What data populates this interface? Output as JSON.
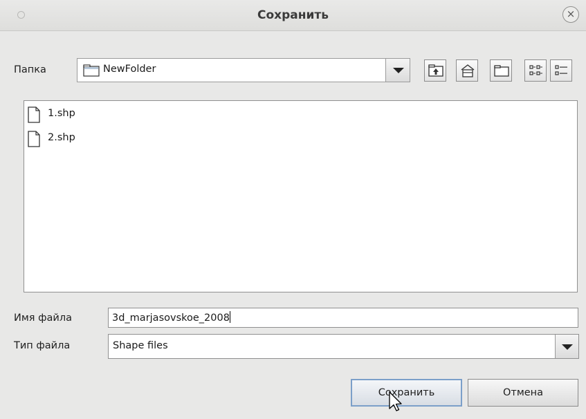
{
  "window": {
    "title": "Сохранить",
    "close_glyph": "×"
  },
  "folder": {
    "label": "Папка",
    "current": "NewFolder"
  },
  "toolbar": {
    "icons": [
      "up-one-level-icon",
      "home-icon",
      "new-folder-icon",
      "list-view-icon",
      "details-view-icon"
    ]
  },
  "files": [
    {
      "name": "1.shp",
      "icon": "file-icon"
    },
    {
      "name": "2.shp",
      "icon": "file-icon"
    }
  ],
  "filename": {
    "label": "Имя файла",
    "value": "3d_marjasovskoe_2008"
  },
  "filetype": {
    "label": "Тип файла",
    "selected": "Shape files"
  },
  "buttons": {
    "save": "Сохранить",
    "cancel": "Отмена"
  }
}
